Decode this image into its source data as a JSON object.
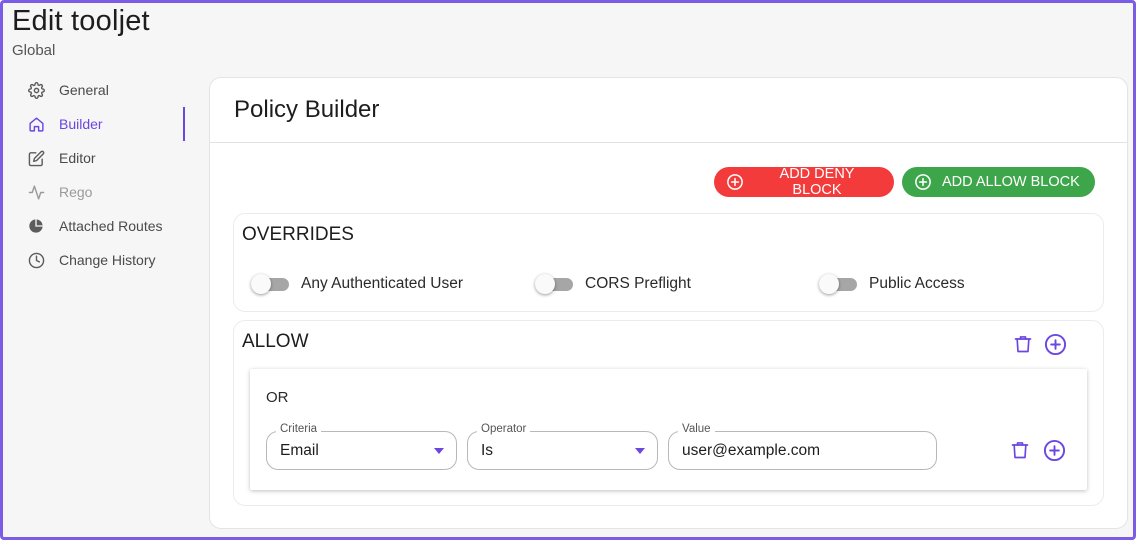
{
  "page": {
    "title": "Edit tooljet",
    "subtitle": "Global"
  },
  "sidebar": {
    "items": [
      {
        "label": "General",
        "icon": "gear-icon",
        "state": "normal"
      },
      {
        "label": "Builder",
        "icon": "home-icon",
        "state": "active"
      },
      {
        "label": "Editor",
        "icon": "edit-icon",
        "state": "normal"
      },
      {
        "label": "Rego",
        "icon": "activity-icon",
        "state": "disabled"
      },
      {
        "label": "Attached Routes",
        "icon": "pie-chart-icon",
        "state": "normal"
      },
      {
        "label": "Change History",
        "icon": "clock-icon",
        "state": "normal"
      }
    ]
  },
  "builder": {
    "title": "Policy Builder",
    "deny_button": "ADD DENY BLOCK",
    "allow_button": "ADD ALLOW BLOCK",
    "overrides": {
      "title": "OVERRIDES",
      "toggles": [
        {
          "label": "Any Authenticated User",
          "on": false
        },
        {
          "label": "CORS Preflight",
          "on": false
        },
        {
          "label": "Public Access",
          "on": false
        }
      ]
    },
    "allow": {
      "title": "ALLOW",
      "or_label": "OR",
      "rule": {
        "criteria_label": "Criteria",
        "criteria_value": "Email",
        "operator_label": "Operator",
        "operator_value": "Is",
        "value_label": "Value",
        "value_value": "user@example.com"
      }
    }
  },
  "colors": {
    "accent": "#6b46e0",
    "deny": "#f33b3b",
    "allow": "#3ea64a",
    "frame": "#7b5ce6"
  }
}
